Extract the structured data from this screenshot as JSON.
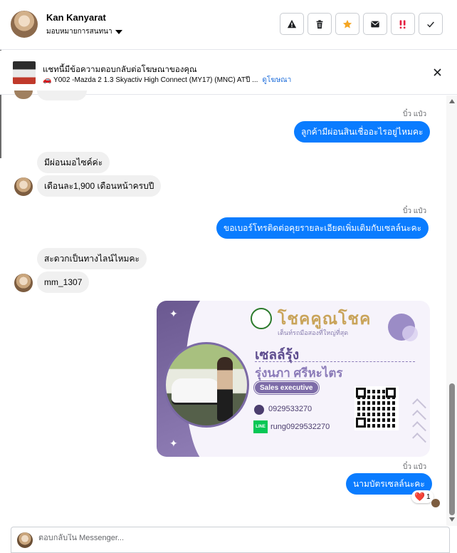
{
  "header": {
    "user_name": "Kan Kanyarat",
    "assign_label": "มอบหมายการสนทนา",
    "actions": [
      {
        "icon": "warning-icon"
      },
      {
        "icon": "trash-icon"
      },
      {
        "icon": "star-icon"
      },
      {
        "icon": "mail-icon"
      },
      {
        "icon": "follow-up-icon"
      },
      {
        "icon": "check-icon"
      }
    ]
  },
  "ad": {
    "title": "แชทนี้มีข้อความตอบกลับต่อโฆษณาของคุณ",
    "subtitle": "🚗 Y002 -Mazda 2 1.3 Skyactiv High Connect (MY17) (MNC) ATปี ...",
    "link": "ดูโฆษณา"
  },
  "messages": [
    {
      "direction": "out",
      "sender": "บิ๋ว แป๋ว",
      "text": "ลูกค้ามีผ่อนสินเชื่ออะไรอยู่ไหมคะ"
    },
    {
      "direction": "in",
      "text": "มีผ่อนมอไซค์ค่ะ"
    },
    {
      "direction": "in",
      "text": "เดือนละ1,900 เดือนหน้าครบปี"
    },
    {
      "direction": "out",
      "sender": "บิ๋ว แป๋ว",
      "text": "ขอเบอร์โทรติดต่อคุยรายละเอียดเพิ่มเติมกับเซลล์นะคะ"
    },
    {
      "direction": "in",
      "text": "สะดวกเป็นทางไลน์ไหมคะ"
    },
    {
      "direction": "in",
      "text": "mm_1307"
    },
    {
      "direction": "out",
      "sender": "บิ๋ว แป๋ว",
      "text": "นามบัตรเซลล์นะคะ",
      "reaction": "❤️",
      "reaction_count": "1"
    }
  ],
  "business_card": {
    "brand": "โชคคูณโชค",
    "tagline": "เต็นท์รถมือสองที่ใหญ่ที่สุด",
    "nickname": "เซลล์รุ้ง",
    "full_name": "รุ่งนภา ศรีหะไตร",
    "role": "Sales executive",
    "phone": "0929533270",
    "line_label": "LINE",
    "line_id": "rung0929532270",
    "accent_color": "#7d6ca8",
    "brand_color": "#c9a45a"
  },
  "composer": {
    "placeholder": "ตอบกลับใน Messenger..."
  },
  "colors": {
    "outgoing_bubble": "#0a7cff",
    "incoming_bubble": "#f0f0f0",
    "link": "#216fdb"
  }
}
